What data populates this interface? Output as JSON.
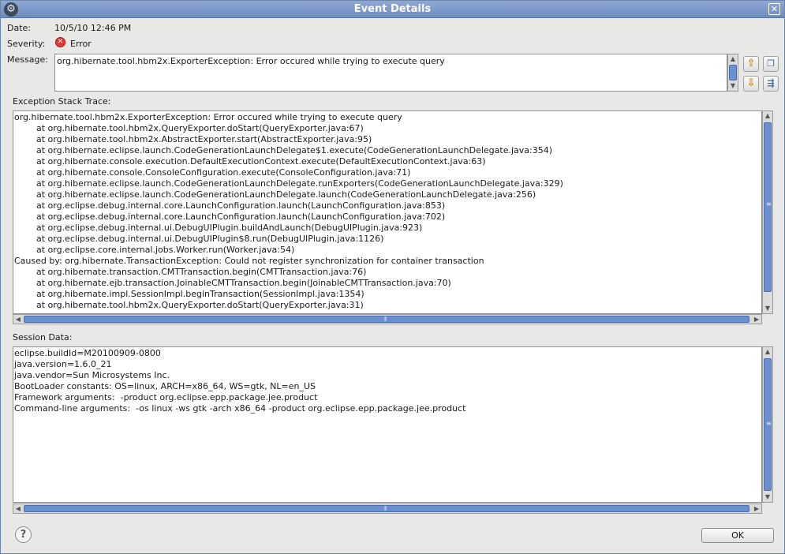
{
  "window": {
    "title": "Event Details"
  },
  "details": {
    "date_label": "Date:",
    "date_value": "10/5/10 12:46 PM",
    "severity_label": "Severity:",
    "severity_value": "Error",
    "message_label": "Message:",
    "message_value": "org.hibernate.tool.hbm2x.ExporterException: Error occured while trying to execute query"
  },
  "stack": {
    "label": "Exception Stack Trace:",
    "lines": [
      "org.hibernate.tool.hbm2x.ExporterException: Error occured while trying to execute query",
      "        at org.hibernate.tool.hbm2x.QueryExporter.doStart(QueryExporter.java:67)",
      "        at org.hibernate.tool.hbm2x.AbstractExporter.start(AbstractExporter.java:95)",
      "        at org.hibernate.eclipse.launch.CodeGenerationLaunchDelegate$1.execute(CodeGenerationLaunchDelegate.java:354)",
      "        at org.hibernate.console.execution.DefaultExecutionContext.execute(DefaultExecutionContext.java:63)",
      "        at org.hibernate.console.ConsoleConfiguration.execute(ConsoleConfiguration.java:71)",
      "        at org.hibernate.eclipse.launch.CodeGenerationLaunchDelegate.runExporters(CodeGenerationLaunchDelegate.java:329)",
      "        at org.hibernate.eclipse.launch.CodeGenerationLaunchDelegate.launch(CodeGenerationLaunchDelegate.java:256)",
      "        at org.eclipse.debug.internal.core.LaunchConfiguration.launch(LaunchConfiguration.java:853)",
      "        at org.eclipse.debug.internal.core.LaunchConfiguration.launch(LaunchConfiguration.java:702)",
      "        at org.eclipse.debug.internal.ui.DebugUIPlugin.buildAndLaunch(DebugUIPlugin.java:923)",
      "        at org.eclipse.debug.internal.ui.DebugUIPlugin$8.run(DebugUIPlugin.java:1126)",
      "        at org.eclipse.core.internal.jobs.Worker.run(Worker.java:54)",
      "Caused by: org.hibernate.TransactionException: Could not register synchronization for container transaction",
      "        at org.hibernate.transaction.CMTTransaction.begin(CMTTransaction.java:76)",
      "        at org.hibernate.ejb.transaction.JoinableCMTTransaction.begin(JoinableCMTTransaction.java:70)",
      "        at org.hibernate.impl.SessionImpl.beginTransaction(SessionImpl.java:1354)",
      "        at org.hibernate.tool.hbm2x.QueryExporter.doStart(QueryExporter.java:31)"
    ]
  },
  "session": {
    "label": "Session Data:",
    "lines": [
      "eclipse.buildId=M20100909-0800",
      "java.version=1.6.0_21",
      "java.vendor=Sun Microsystems Inc.",
      "BootLoader constants: OS=linux, ARCH=x86_64, WS=gtk, NL=en_US",
      "Framework arguments:  -product org.eclipse.epp.package.jee.product",
      "Command-line arguments:  -os linux -ws gtk -arch x86_64 -product org.eclipse.epp.package.jee.product"
    ]
  },
  "buttons": {
    "ok": "OK"
  },
  "icons": {
    "menu": "gear-icon",
    "close": "close-icon",
    "severity": "error-icon",
    "previous": "arrow-up-icon",
    "next": "arrow-down-icon",
    "copy": "copy-icon",
    "filter": "filter-icon",
    "help": "help-icon"
  },
  "colors": {
    "titlebar": "#7b96c8",
    "scroll_thumb": "#6c8fd0",
    "window_bg": "#e8e8e7"
  }
}
